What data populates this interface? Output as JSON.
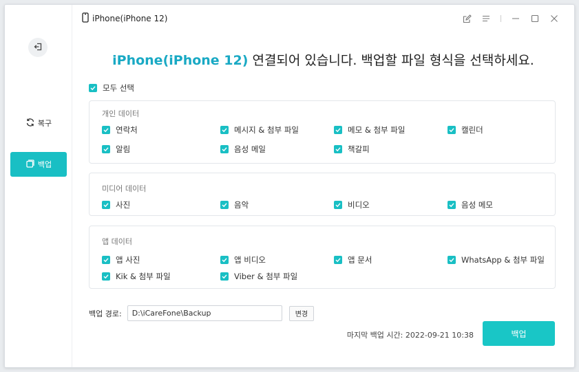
{
  "window": {
    "device_label": "iPhone(iPhone 12)",
    "controls": [
      "edit-icon",
      "menu-icon",
      "minimize-icon",
      "maximize-icon",
      "close-icon"
    ]
  },
  "sidebar": {
    "back_icon": "exit-icon",
    "items": [
      {
        "label": "복구",
        "icon": "refresh-icon",
        "active": false
      },
      {
        "label": "백업",
        "icon": "backup-icon",
        "active": true
      }
    ]
  },
  "main": {
    "heading_device": "iPhone(iPhone 12)",
    "heading_text": " 연결되어 있습니다. 백업할 파일 형식을 선택하세요.",
    "select_all_label": "모두 선택",
    "groups": [
      {
        "title": "개인 데이터",
        "items": [
          {
            "label": "연락처",
            "checked": true
          },
          {
            "label": "메시지 & 첨부 파일",
            "checked": true
          },
          {
            "label": "메모 & 첨부 파일",
            "checked": true
          },
          {
            "label": "캘린더",
            "checked": true
          },
          {
            "label": "알림",
            "checked": true
          },
          {
            "label": "음성 메일",
            "checked": true
          },
          {
            "label": "책갈피",
            "checked": true
          }
        ]
      },
      {
        "title": "미디어 데이터",
        "items": [
          {
            "label": "사진",
            "checked": true
          },
          {
            "label": "음악",
            "checked": true
          },
          {
            "label": "비디오",
            "checked": true
          },
          {
            "label": "음성 메모",
            "checked": true
          }
        ]
      },
      {
        "title": "앱 데이터",
        "items": [
          {
            "label": "앱 사진",
            "checked": true
          },
          {
            "label": "앱 비디오",
            "checked": true
          },
          {
            "label": "앱 문서",
            "checked": true
          },
          {
            "label": "WhatsApp & 첨부 파일",
            "checked": true
          },
          {
            "label": "Kik & 첨부 파일",
            "checked": true
          },
          {
            "label": "Viber & 첨부 파일",
            "checked": true
          }
        ]
      }
    ],
    "path_label": "백업 경로:",
    "path_value": "D:\\iCareFone\\Backup",
    "change_button": "변경",
    "last_backup": "마지막 백업 시간: 2022-09-21 10:38",
    "backup_button": "백업"
  },
  "colors": {
    "accent": "#19bfc4",
    "heading_highlight": "#19a9c4"
  }
}
